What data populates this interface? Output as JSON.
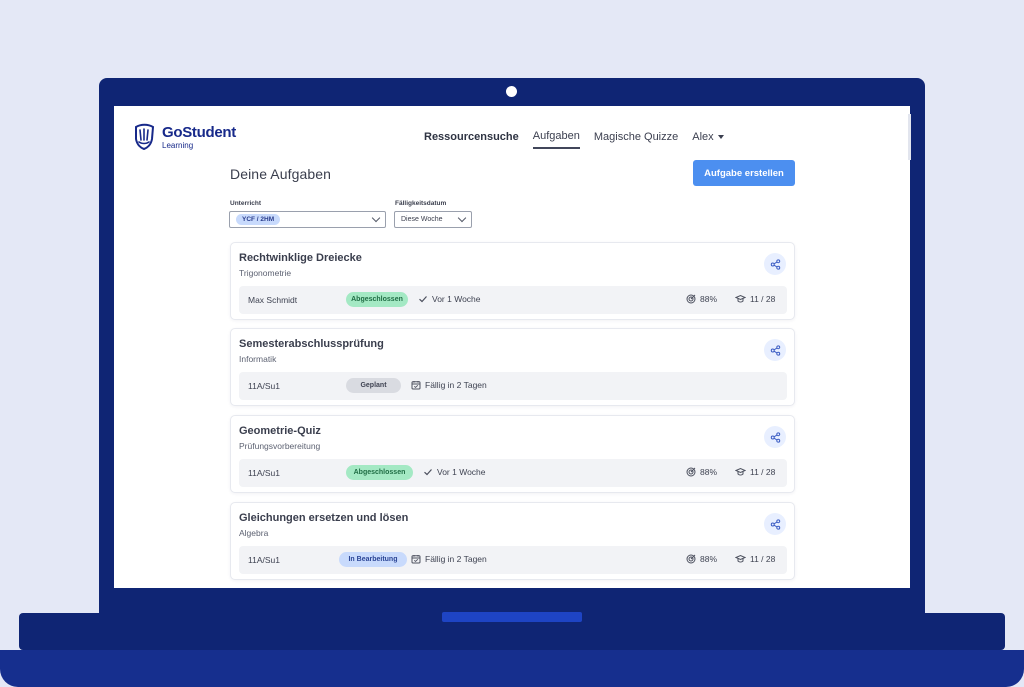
{
  "brand": {
    "name": "GoStudent",
    "sub": "Learning"
  },
  "nav": {
    "items": [
      "Ressourcensuche",
      "Aufgaben",
      "Magische Quizze"
    ],
    "active": "Aufgaben",
    "user": "Alex"
  },
  "page": {
    "title": "Deine Aufgaben",
    "create_button": "Aufgabe erstellen"
  },
  "filters": {
    "class": {
      "label": "Unterricht",
      "value": "YCF / 2HM"
    },
    "due": {
      "label": "Fälligkeitsdatum",
      "value": "Diese Woche"
    }
  },
  "assignments": [
    {
      "title": "Rechtwinklige Dreiecke",
      "subject": "Trigonometrie",
      "owner": "Max Schmidt",
      "status": "Abgeschlossen",
      "status_type": "done",
      "timing": "Vor 1 Woche",
      "timing_icon": "check-icon",
      "score": "88%",
      "count": "11 / 28"
    },
    {
      "title": "Semesterabschlussprüfung",
      "subject": "Informatik",
      "owner": "11A/Su1",
      "status": "Geplant",
      "status_type": "planned",
      "timing": "Fällig in 2 Tagen",
      "timing_icon": "calendar-icon",
      "score": "",
      "count": ""
    },
    {
      "title": "Geometrie-Quiz",
      "subject": "Prüfungsvorbereitung",
      "owner": "11A/Su1",
      "status": "Abgeschlossen",
      "status_type": "done",
      "timing": "Vor 1 Woche",
      "timing_icon": "check-icon",
      "score": "88%",
      "count": "11 / 28"
    },
    {
      "title": "Gleichungen ersetzen und lösen",
      "subject": "Algebra",
      "owner": "11A/Su1",
      "status": "In Bearbeitung",
      "status_type": "progress",
      "timing": "Fällig in 2 Tagen",
      "timing_icon": "calendar-icon",
      "score": "88%",
      "count": "11 / 28"
    }
  ],
  "colors": {
    "primary": "#4c8ff0",
    "brand": "#17298a",
    "laptop": "#0f2574",
    "badge_done": "#a4e9c4",
    "badge_planned": "#d9dbe1",
    "badge_progress": "#c8dafc"
  }
}
